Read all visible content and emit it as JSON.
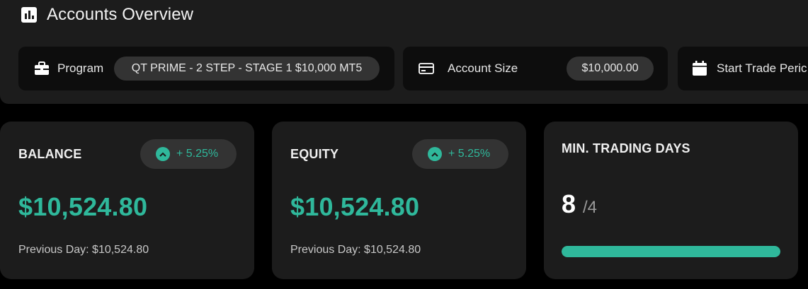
{
  "header": {
    "title": "Accounts Overview",
    "icon": "bar-chart-icon"
  },
  "info": {
    "program": {
      "label": "Program",
      "value": "QT PRIME - 2 STEP - STAGE 1 $10,000 MT5",
      "icon": "briefcase-icon"
    },
    "account_size": {
      "label": "Account Size",
      "value": "$10,000.00",
      "icon": "credit-card-icon"
    },
    "start_trade": {
      "label": "Start Trade Peric",
      "icon": "calendar-icon"
    }
  },
  "balance": {
    "label": "BALANCE",
    "change": "+ 5.25%",
    "value": "$10,524.80",
    "previous": "Previous Day: $10,524.80"
  },
  "equity": {
    "label": "EQUITY",
    "change": "+ 5.25%",
    "value": "$10,524.80",
    "previous": "Previous Day: $10,524.80"
  },
  "trading_days": {
    "label": "MIN. TRADING DAYS",
    "current": "8",
    "required": "/4",
    "progress": 1.0
  },
  "colors": {
    "accent": "#2fb89b",
    "card": "#1c1c1c",
    "pill": "#333333"
  }
}
